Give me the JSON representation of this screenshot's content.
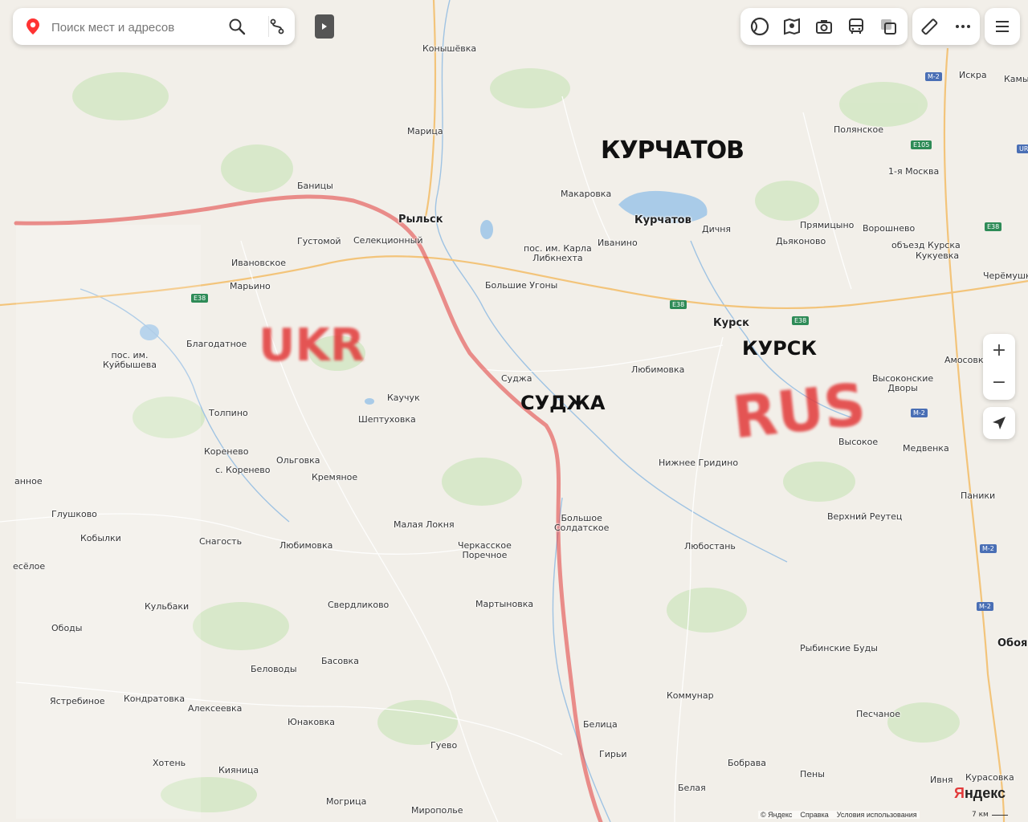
{
  "search": {
    "placeholder": "Поиск мест и адресов"
  },
  "toolbar": {
    "buttons": [
      "layers-icon",
      "panorama-icon",
      "photo-icon",
      "transit-icon",
      "map-type-icon"
    ],
    "ruler": "ruler-icon",
    "more": "more-icon",
    "menu": "menu-icon"
  },
  "zoom": {
    "in": "+",
    "out": "−"
  },
  "annotations": {
    "ukr": "UKR",
    "rus": "RUS",
    "kurchatov": "КУРЧАТОВ",
    "kursk": "КУРСК",
    "sudzha": "СУДЖА"
  },
  "brand": {
    "name_a": "Я",
    "name_b": "ндекс"
  },
  "footer": {
    "copyright": "© Яндекс",
    "help": "Справка",
    "terms": "Условия использования",
    "scale": "7 км"
  },
  "places": [
    {
      "id": "konyshevka",
      "name": "Конышёвка"
    },
    {
      "id": "iskra",
      "name": "Искра"
    },
    {
      "id": "kamy",
      "name": "Камы"
    },
    {
      "id": "marica",
      "name": "Марица"
    },
    {
      "id": "polyanskoe",
      "name": "Полянское"
    },
    {
      "id": "moskva1",
      "name": "1-я Москва"
    },
    {
      "id": "banicy",
      "name": "Баницы"
    },
    {
      "id": "makarovka",
      "name": "Макаровка"
    },
    {
      "id": "rylsk",
      "name": "Рыльск"
    },
    {
      "id": "kurchatov",
      "name": "Курчатов"
    },
    {
      "id": "dichnya",
      "name": "Дичня"
    },
    {
      "id": "pryamicyno",
      "name": "Прямицыно"
    },
    {
      "id": "voroshnevo",
      "name": "Ворошнево"
    },
    {
      "id": "gustomoy",
      "name": "Густомой"
    },
    {
      "id": "selekcionny",
      "name": "Селекционный"
    },
    {
      "id": "ivanino",
      "name": "Иванино"
    },
    {
      "id": "dyakonovo",
      "name": "Дьяконово"
    },
    {
      "id": "karla",
      "name": "пос. им. Карла\nЛибкнехта"
    },
    {
      "id": "obezd",
      "name": "объезд Курска"
    },
    {
      "id": "kukuevka",
      "name": "Кукуевка"
    },
    {
      "id": "ivanovskoe",
      "name": "Ивановское"
    },
    {
      "id": "cheremush",
      "name": "Черёмушк"
    },
    {
      "id": "bolugony",
      "name": "Большие Угоны"
    },
    {
      "id": "maryino",
      "name": "Марьино"
    },
    {
      "id": "kursk",
      "name": "Курск"
    },
    {
      "id": "blagodatnoe",
      "name": "Благодатное"
    },
    {
      "id": "kuybysheva",
      "name": "пос. им.\nКуйбышева"
    },
    {
      "id": "amosovka",
      "name": "Амосовка"
    },
    {
      "id": "lyubimovka1",
      "name": "Любимовка"
    },
    {
      "id": "sudzha",
      "name": "Суджа"
    },
    {
      "id": "vysokonskie",
      "name": "Высоконские\nДворы"
    },
    {
      "id": "kauchuk",
      "name": "Каучук"
    },
    {
      "id": "tolpino",
      "name": "Толпино"
    },
    {
      "id": "sheptuhovka",
      "name": "Шептуховка"
    },
    {
      "id": "vysokoe",
      "name": "Высокое"
    },
    {
      "id": "cher_r",
      "name": "Чер"
    },
    {
      "id": "medvenka",
      "name": "Медвенка"
    },
    {
      "id": "korenevo",
      "name": "Коренево"
    },
    {
      "id": "olgovka",
      "name": "Ольговка"
    },
    {
      "id": "nizhgridino",
      "name": "Нижнее Гридино"
    },
    {
      "id": "skorenevo",
      "name": "с. Коренево"
    },
    {
      "id": "kremyanoe",
      "name": "Кремяное"
    },
    {
      "id": "annoe",
      "name": "анное"
    },
    {
      "id": "paniki",
      "name": "Паники"
    },
    {
      "id": "glushkovo",
      "name": "Глушково"
    },
    {
      "id": "verhreutec",
      "name": "Верхний Реутец"
    },
    {
      "id": "bolsoldat",
      "name": "Большое\nСолдатское"
    },
    {
      "id": "malaylokna",
      "name": "Малая Локня"
    },
    {
      "id": "kobylki",
      "name": "Кобылки"
    },
    {
      "id": "snagost",
      "name": "Снагость"
    },
    {
      "id": "lyubimovka2",
      "name": "Любимовка"
    },
    {
      "id": "cherkasskoe",
      "name": "Черкасское\nПоречное"
    },
    {
      "id": "lyubostan",
      "name": "Любостань"
    },
    {
      "id": "vesyoloe",
      "name": "есёлое"
    },
    {
      "id": "martynovka",
      "name": "Мартыновка"
    },
    {
      "id": "kulbaki",
      "name": "Кульбаки"
    },
    {
      "id": "sverdlikovo",
      "name": "Свердликово"
    },
    {
      "id": "obody",
      "name": "Ободы"
    },
    {
      "id": "oboyan",
      "name": "Обоян"
    },
    {
      "id": "rybinskie",
      "name": "Рыбинские Буды"
    },
    {
      "id": "belovody",
      "name": "Беловоды"
    },
    {
      "id": "basovka",
      "name": "Басовка"
    },
    {
      "id": "kommunar",
      "name": "Коммунар"
    },
    {
      "id": "yastrebinoe",
      "name": "Ястребиное"
    },
    {
      "id": "kondratovka",
      "name": "Кондратовка"
    },
    {
      "id": "alekseevka",
      "name": "Алексеевка"
    },
    {
      "id": "peschanoe",
      "name": "Песчаное"
    },
    {
      "id": "yunakovka",
      "name": "Юнаковка"
    },
    {
      "id": "belica",
      "name": "Белица"
    },
    {
      "id": "guevo",
      "name": "Гуево"
    },
    {
      "id": "hoten",
      "name": "Хотень"
    },
    {
      "id": "giryi",
      "name": "Гирьи"
    },
    {
      "id": "bobrava",
      "name": "Бобрава"
    },
    {
      "id": "kiyanica",
      "name": "Кияница"
    },
    {
      "id": "peny",
      "name": "Пены"
    },
    {
      "id": "ivnya",
      "name": "Ивня"
    },
    {
      "id": "kurasovka",
      "name": "Курасовка"
    },
    {
      "id": "belaya",
      "name": "Белая"
    },
    {
      "id": "mogrica",
      "name": "Могрица"
    },
    {
      "id": "miropolye",
      "name": "Мирополье"
    }
  ],
  "road_shields": [
    {
      "id": "m2a",
      "label": "М-2"
    },
    {
      "id": "e105",
      "label": "E105"
    },
    {
      "id": "e38a",
      "label": "E38"
    },
    {
      "id": "e38b",
      "label": "E38"
    },
    {
      "id": "e38c",
      "label": "E38"
    },
    {
      "id": "e38d",
      "label": "E38"
    },
    {
      "id": "m2b",
      "label": "М-2"
    },
    {
      "id": "m2c",
      "label": "М-2"
    },
    {
      "id": "m2d",
      "label": "М-2"
    },
    {
      "id": "ur",
      "label": "UR"
    }
  ]
}
